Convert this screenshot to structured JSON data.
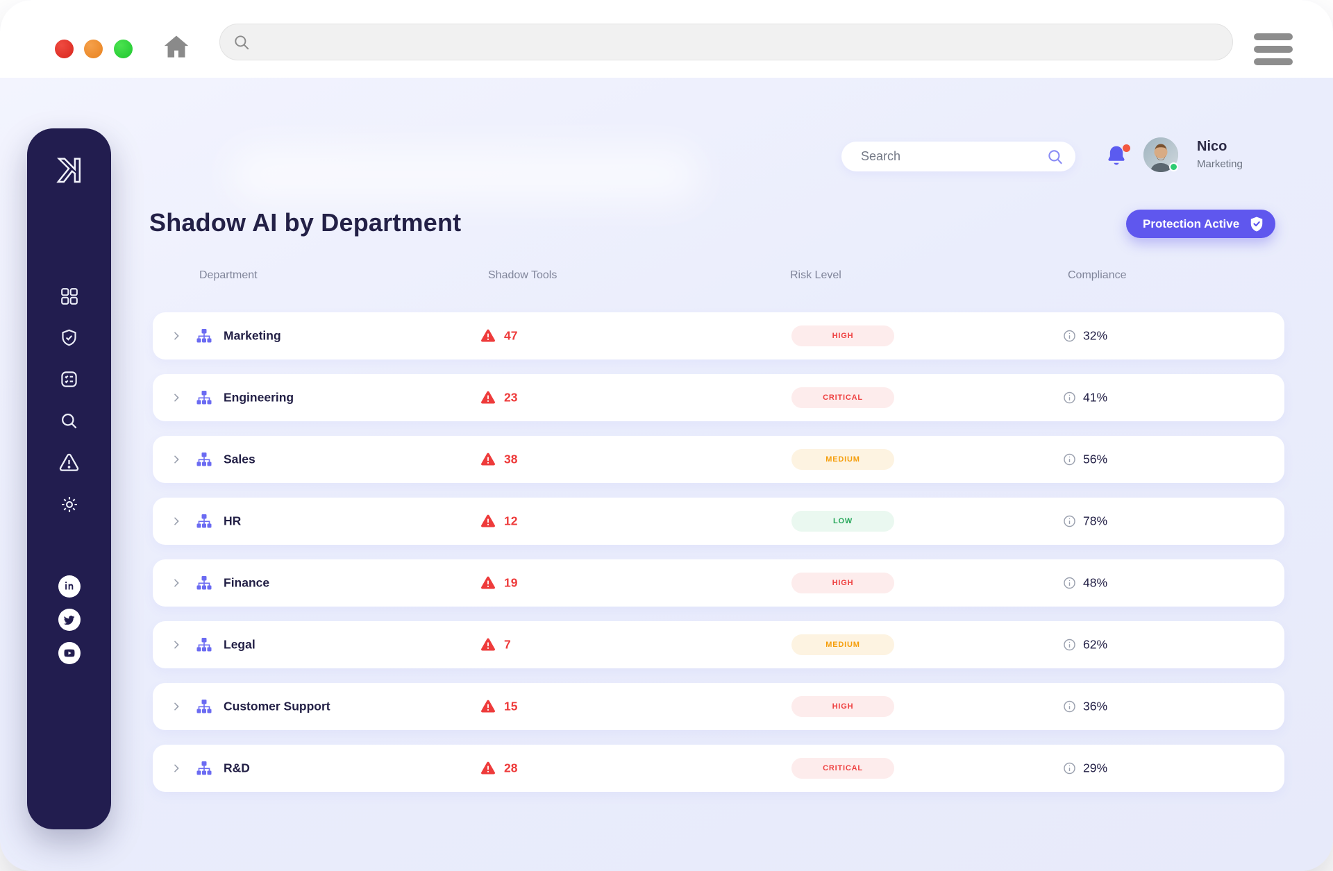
{
  "browser": {
    "traffic_lights": [
      "#d8261d",
      "#e8821f",
      "#1fc72f"
    ],
    "url_value": "",
    "home_icon": "home",
    "menu_icon": "hamburger"
  },
  "sidebar": {
    "logo": "K",
    "bg_color": "#221d4f",
    "nav": [
      {
        "icon": "grid-dashboard"
      },
      {
        "icon": "shield-check"
      },
      {
        "icon": "checklist"
      },
      {
        "icon": "search"
      },
      {
        "icon": "alert-triangle"
      },
      {
        "icon": "gear"
      }
    ],
    "socials": [
      {
        "icon": "linkedin",
        "label": "in"
      },
      {
        "icon": "twitter"
      },
      {
        "icon": "youtube"
      }
    ]
  },
  "header": {
    "search_placeholder": "Search",
    "notifications": {
      "icon": "bell",
      "has_unread": true
    },
    "user": {
      "name": "Nico",
      "role": "Marketing",
      "status": "online"
    }
  },
  "page": {
    "title": "Shadow AI by Department",
    "protection_button": "Protection Active",
    "accent_color": "#5f57ee"
  },
  "table": {
    "columns": [
      "Department",
      "Shadow Tools",
      "Risk Level",
      "Compliance"
    ],
    "rows": [
      {
        "department": "Marketing",
        "shadow_tools": 47,
        "risk_level": "HIGH",
        "compliance": "32%"
      },
      {
        "department": "Engineering",
        "shadow_tools": 23,
        "risk_level": "CRITICAL",
        "compliance": "41%"
      },
      {
        "department": "Sales",
        "shadow_tools": 38,
        "risk_level": "MEDIUM",
        "compliance": "56%"
      },
      {
        "department": "HR",
        "shadow_tools": 12,
        "risk_level": "LOW",
        "compliance": "78%"
      },
      {
        "department": "Finance",
        "shadow_tools": 19,
        "risk_level": "HIGH",
        "compliance": "48%"
      },
      {
        "department": "Legal",
        "shadow_tools": 7,
        "risk_level": "MEDIUM",
        "compliance": "62%"
      },
      {
        "department": "Customer Support",
        "shadow_tools": 15,
        "risk_level": "HIGH",
        "compliance": "36%"
      },
      {
        "department": "R&D",
        "shadow_tools": 28,
        "risk_level": "CRITICAL",
        "compliance": "29%"
      }
    ],
    "risk_colors": {
      "HIGH": {
        "text": "#ee4040",
        "bg": "#fdecec"
      },
      "CRITICAL": {
        "text": "#ee4040",
        "bg": "#fdecec"
      },
      "MEDIUM": {
        "text": "#f59e0b",
        "bg": "#fdf3e1"
      },
      "LOW": {
        "text": "#27a75a",
        "bg": "#eaf8f0"
      }
    },
    "tools_alert_color": "#ee3b3b"
  }
}
